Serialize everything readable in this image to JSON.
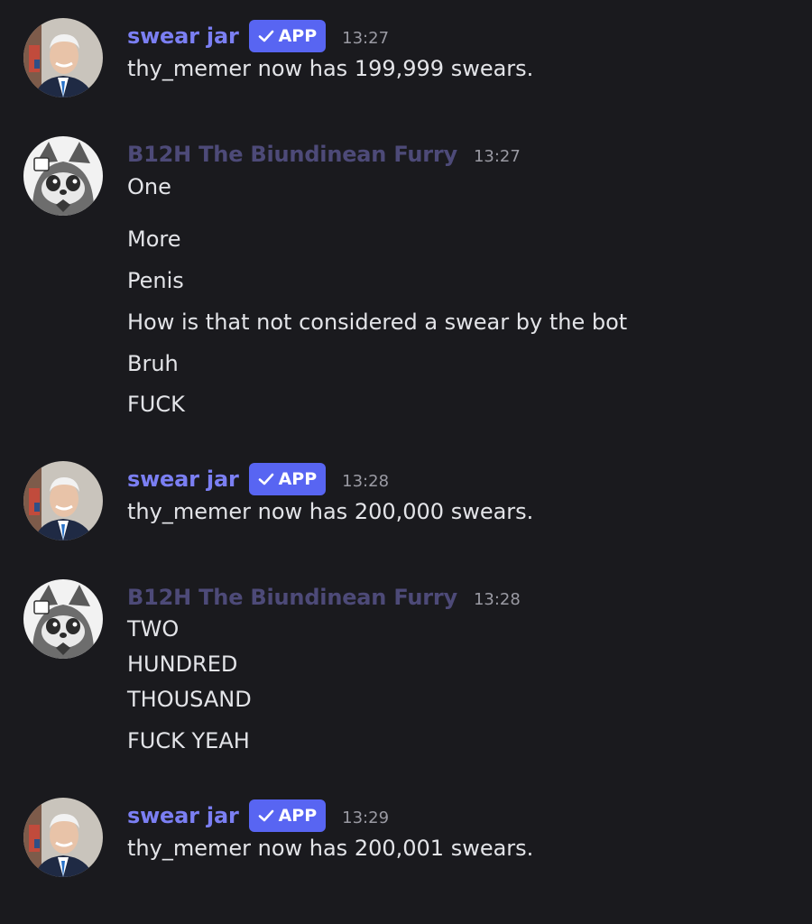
{
  "messages": [
    {
      "author": "swear jar",
      "is_bot": true,
      "badge": "APP",
      "time": "13:27",
      "avatar": "biden-portrait-avatar",
      "lines": [
        "thy_memer now has 199,999 swears."
      ]
    },
    {
      "author": "B12H The Biundinean Furry",
      "is_bot": false,
      "time": "13:27",
      "avatar": "furry-raccoon-avatar",
      "lines": [
        "One",
        "More",
        "Penis",
        "How is that not considered a swear by the bot",
        "Bruh",
        "FUCK"
      ]
    },
    {
      "author": "swear jar",
      "is_bot": true,
      "badge": "APP",
      "time": "13:28",
      "avatar": "biden-portrait-avatar",
      "lines": [
        "thy_memer now has 200,000 swears."
      ]
    },
    {
      "author": "B12H The Biundinean Furry",
      "is_bot": false,
      "time": "13:28",
      "avatar": "furry-raccoon-avatar",
      "lines": [
        "TWO",
        "HUNDRED",
        "THOUSAND",
        "FUCK YEAH"
      ]
    },
    {
      "author": "swear jar",
      "is_bot": true,
      "badge": "APP",
      "time": "13:29",
      "avatar": "biden-portrait-avatar",
      "lines": [
        "thy_memer now has 200,001 swears."
      ]
    }
  ],
  "colors": {
    "background": "#1a1a1e",
    "bot_name": "#7b7ff3",
    "user_name": "#4d4a78",
    "app_badge": "#5865f2",
    "timestamp": "#9a9aa3",
    "message_text": "#e3e4e8"
  }
}
